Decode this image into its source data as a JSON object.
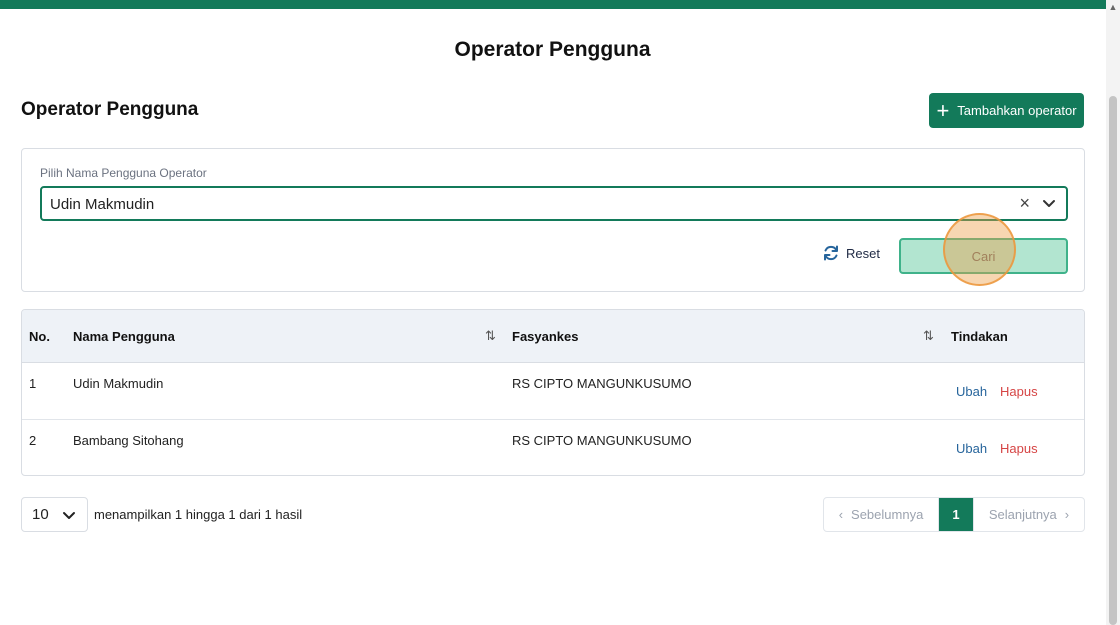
{
  "page": {
    "heading": "Operator Pengguna",
    "section_title": "Operator Pengguna",
    "accent_color": "#137a5a"
  },
  "actions": {
    "add_label": "Tambahkan operator"
  },
  "filter": {
    "label": "Pilih Nama Pengguna Operator",
    "selected_value": "Udin Makmudin",
    "clear_icon": "×",
    "reset_label": "Reset",
    "search_label": "Cari"
  },
  "table": {
    "columns": [
      "No.",
      "Nama Pengguna",
      "Fasyankes",
      "Tindakan"
    ],
    "sort_icon": "⇅",
    "rows": [
      {
        "no": "1",
        "name": "Udin Makmudin",
        "facility": "RS CIPTO MANGUNKUSUMO",
        "edit": "Ubah",
        "delete": "Hapus"
      },
      {
        "no": "2",
        "name": "Bambang Sitohang",
        "facility": "RS CIPTO MANGUNKUSUMO",
        "edit": "Ubah",
        "delete": "Hapus"
      }
    ]
  },
  "pagination": {
    "per_page": "10",
    "summary": "menampilkan 1 hingga 1 dari 1 hasil",
    "prev_label": "Sebelumnya",
    "next_label": "Selanjutnya",
    "current_page": "1"
  }
}
